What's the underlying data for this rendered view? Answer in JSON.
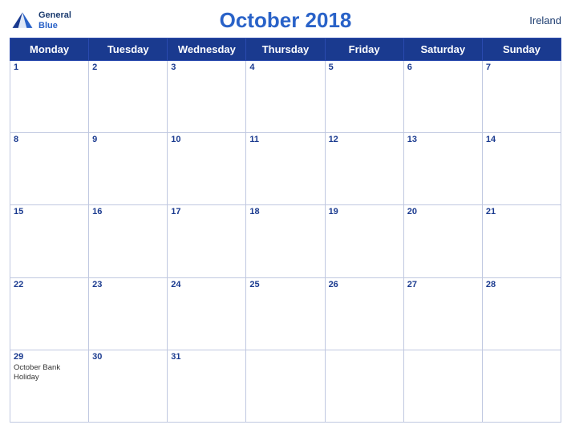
{
  "header": {
    "title": "October 2018",
    "country": "Ireland",
    "logo_general": "General",
    "logo_blue": "Blue"
  },
  "days_of_week": [
    "Monday",
    "Tuesday",
    "Wednesday",
    "Thursday",
    "Friday",
    "Saturday",
    "Sunday"
  ],
  "weeks": [
    [
      {
        "day": "1",
        "events": []
      },
      {
        "day": "2",
        "events": []
      },
      {
        "day": "3",
        "events": []
      },
      {
        "day": "4",
        "events": []
      },
      {
        "day": "5",
        "events": []
      },
      {
        "day": "6",
        "events": []
      },
      {
        "day": "7",
        "events": []
      }
    ],
    [
      {
        "day": "8",
        "events": []
      },
      {
        "day": "9",
        "events": []
      },
      {
        "day": "10",
        "events": []
      },
      {
        "day": "11",
        "events": []
      },
      {
        "day": "12",
        "events": []
      },
      {
        "day": "13",
        "events": []
      },
      {
        "day": "14",
        "events": []
      }
    ],
    [
      {
        "day": "15",
        "events": []
      },
      {
        "day": "16",
        "events": []
      },
      {
        "day": "17",
        "events": []
      },
      {
        "day": "18",
        "events": []
      },
      {
        "day": "19",
        "events": []
      },
      {
        "day": "20",
        "events": []
      },
      {
        "day": "21",
        "events": []
      }
    ],
    [
      {
        "day": "22",
        "events": []
      },
      {
        "day": "23",
        "events": []
      },
      {
        "day": "24",
        "events": []
      },
      {
        "day": "25",
        "events": []
      },
      {
        "day": "26",
        "events": []
      },
      {
        "day": "27",
        "events": []
      },
      {
        "day": "28",
        "events": []
      }
    ],
    [
      {
        "day": "29",
        "events": [
          "October Bank Holiday"
        ]
      },
      {
        "day": "30",
        "events": []
      },
      {
        "day": "31",
        "events": []
      },
      {
        "day": "",
        "events": []
      },
      {
        "day": "",
        "events": []
      },
      {
        "day": "",
        "events": []
      },
      {
        "day": "",
        "events": []
      }
    ]
  ]
}
